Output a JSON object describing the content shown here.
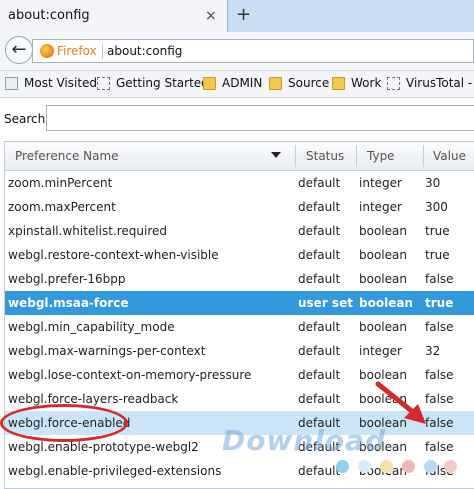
{
  "tab": {
    "title": "about:config",
    "close": "×",
    "new_tab": "+"
  },
  "nav": {
    "back": "←",
    "identity": "Firefox",
    "url": "about:config"
  },
  "bookmarks": [
    {
      "label": "Most Visited",
      "icon": "dashed-square-icon"
    },
    {
      "label": "Getting Started",
      "icon": "dashed-square-icon"
    },
    {
      "label": "ADMIN",
      "icon": "folder-icon"
    },
    {
      "label": "Source",
      "icon": "folder-icon"
    },
    {
      "label": "Work",
      "icon": "folder-icon"
    },
    {
      "label": "VirusTotal - F",
      "icon": "dashed-square-icon"
    }
  ],
  "search": {
    "label": "Search:",
    "value": "",
    "placeholder": ""
  },
  "columns": {
    "name": "Preference Name",
    "status": "Status",
    "type": "Type",
    "value": "Value"
  },
  "rows": [
    {
      "name": "zoom.minPercent",
      "status": "default",
      "type": "integer",
      "value": "30",
      "state": ""
    },
    {
      "name": "zoom.maxPercent",
      "status": "default",
      "type": "integer",
      "value": "300",
      "state": ""
    },
    {
      "name": "xpinstall.whitelist.required",
      "status": "default",
      "type": "boolean",
      "value": "true",
      "state": ""
    },
    {
      "name": "webgl.restore-context-when-visible",
      "status": "default",
      "type": "boolean",
      "value": "true",
      "state": ""
    },
    {
      "name": "webgl.prefer-16bpp",
      "status": "default",
      "type": "boolean",
      "value": "false",
      "state": ""
    },
    {
      "name": "webgl.msaa-force",
      "status": "user set",
      "type": "boolean",
      "value": "true",
      "state": "selected"
    },
    {
      "name": "webgl.min_capability_mode",
      "status": "default",
      "type": "boolean",
      "value": "false",
      "state": ""
    },
    {
      "name": "webgl.max-warnings-per-context",
      "status": "default",
      "type": "integer",
      "value": "32",
      "state": ""
    },
    {
      "name": "webgl.lose-context-on-memory-pressure",
      "status": "default",
      "type": "boolean",
      "value": "false",
      "state": ""
    },
    {
      "name": "webgl.force-layers-readback",
      "status": "default",
      "type": "boolean",
      "value": "false",
      "state": ""
    },
    {
      "name": "webgl.force-enabled",
      "status": "default",
      "type": "boolean",
      "value": "false",
      "state": "highlight"
    },
    {
      "name": "webgl.enable-prototype-webgl2",
      "status": "default",
      "type": "boolean",
      "value": "false",
      "state": ""
    },
    {
      "name": "webgl.enable-privileged-extensions",
      "status": "default",
      "type": "boolean",
      "value": "false",
      "state": ""
    }
  ],
  "watermark": "Download",
  "colors": {
    "selected_row": "#3399dd",
    "highlight_row": "#cbe4f7",
    "annotation": "#d62a2a",
    "identity": "#ef7c22"
  }
}
